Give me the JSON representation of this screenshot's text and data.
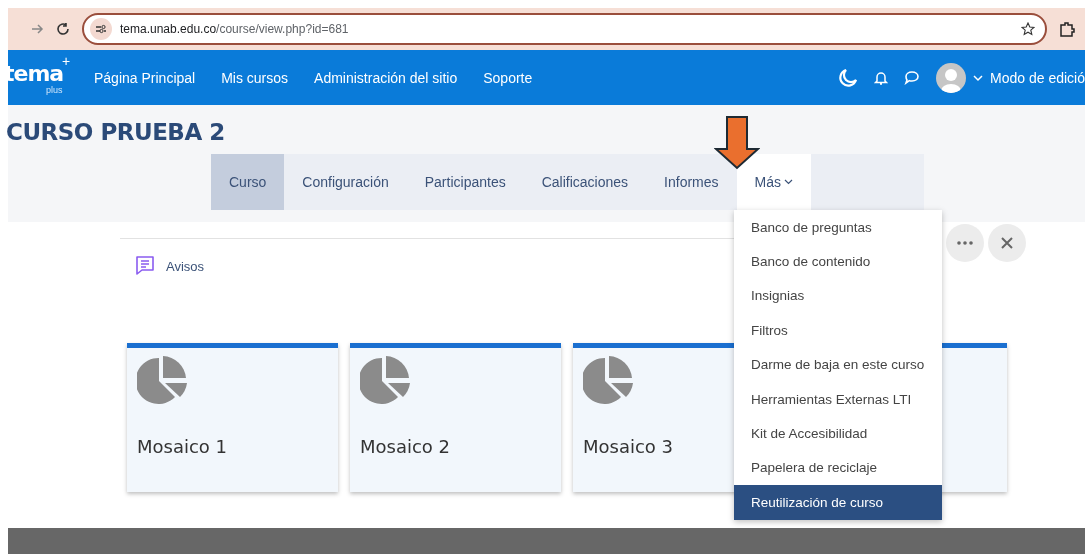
{
  "browser": {
    "url_host": "tema.unab.edu.co",
    "url_path": "/course/view.php?id=681"
  },
  "navbar": {
    "logo": {
      "word": "tema",
      "sub": "plus",
      "plus": "+"
    },
    "links": [
      {
        "label": "Página Principal"
      },
      {
        "label": "Mis cursos"
      },
      {
        "label": "Administración del sitio"
      },
      {
        "label": "Soporte"
      }
    ],
    "edit_mode": "Modo de edició"
  },
  "course_title": "CURSO PRUEBA 2",
  "tabs": [
    {
      "label": "Curso",
      "selected": true,
      "kind": "tab"
    },
    {
      "label": "Configuración",
      "selected": false,
      "kind": "tab"
    },
    {
      "label": "Participantes",
      "selected": false,
      "kind": "tab"
    },
    {
      "label": "Calificaciones",
      "selected": false,
      "kind": "tab"
    },
    {
      "label": "Informes",
      "selected": false,
      "kind": "tab"
    },
    {
      "label": "Más",
      "selected": false,
      "kind": "dropdown",
      "expanded": true
    }
  ],
  "menu": [
    {
      "label": "Banco de preguntas",
      "selected": false
    },
    {
      "label": "Banco de contenido",
      "selected": false
    },
    {
      "label": "Insignias",
      "selected": false
    },
    {
      "label": "Filtros",
      "selected": false
    },
    {
      "label": "Darme de baja en este curso",
      "selected": false
    },
    {
      "label": "Herramientas Externas LTI",
      "selected": false
    },
    {
      "label": "Kit de Accesibilidad",
      "selected": false
    },
    {
      "label": "Papelera de reciclaje",
      "selected": false
    },
    {
      "label": "Reutilización de curso",
      "selected": true
    }
  ],
  "announcements": "Avisos",
  "cards": [
    {
      "kind": "tile",
      "title": "Mosaico 1"
    },
    {
      "kind": "tile",
      "title": "Mosaico 2"
    },
    {
      "kind": "tile",
      "title": "Mosaico 3"
    },
    {
      "kind": "covered"
    }
  ]
}
